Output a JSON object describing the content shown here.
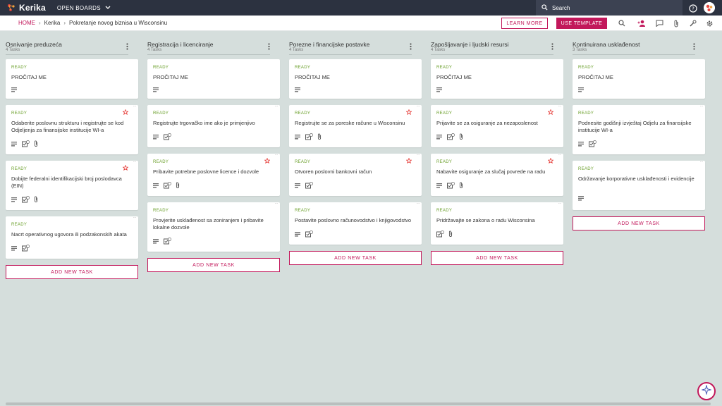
{
  "app": {
    "logo_text": "Kerika",
    "open_boards": "OPEN BOARDS"
  },
  "search": {
    "label": "Search"
  },
  "breadcrumb": {
    "home": "HOME",
    "org": "Kerika",
    "board": "Pokretanje novog biznisa u Wisconsinu"
  },
  "actions": {
    "learn_more": "LEARN MORE",
    "use_template": "USE TEMPLATE"
  },
  "colors": {
    "accent": "#c2185b",
    "ready": "#6a9f2a",
    "topbar": "#2c3240",
    "background": "#d5dedc"
  },
  "add_task_label": "ADD NEW TASK",
  "columns": [
    {
      "title": "Osnivanje preduzeća",
      "count": "4 Tasks",
      "cards": [
        {
          "status": "READY",
          "title": "PROČITAJ ME",
          "star": false,
          "icons": [
            "notes"
          ]
        },
        {
          "status": "READY",
          "title": "Odaberite poslovnu strukturu i registrujte se kod Odjeljenja za finansijske institucije WI-a",
          "star": true,
          "icons": [
            "notes",
            "checklist",
            "attachment"
          ]
        },
        {
          "status": "READY",
          "title": "Dobijte federalni identifikacijski broj poslodavca (EIN)",
          "star": true,
          "icons": [
            "notes",
            "checklist",
            "attachment"
          ]
        },
        {
          "status": "READY",
          "title": "Nacrt operativnog ugovora ili podzakonskih akata",
          "star": false,
          "icons": [
            "notes",
            "checklist"
          ]
        }
      ]
    },
    {
      "title": "Registracija i licenciranje",
      "count": "4 Tasks",
      "cards": [
        {
          "status": "READY",
          "title": "PROČITAJ ME",
          "star": false,
          "icons": [
            "notes"
          ]
        },
        {
          "status": "READY",
          "title": "Registrujte trgovačko ime ako je primjenjivo",
          "star": false,
          "icons": [
            "notes",
            "checklist"
          ]
        },
        {
          "status": "READY",
          "title": "Pribavite potrebne poslovne licence i dozvole",
          "star": true,
          "icons": [
            "notes",
            "checklist",
            "attachment"
          ]
        },
        {
          "status": "READY",
          "title": "Provjerite usklađenost sa zoniranjem i pribavite lokalne dozvole",
          "star": false,
          "icons": [
            "notes",
            "checklist"
          ]
        }
      ]
    },
    {
      "title": "Porezne i financijske postavke",
      "count": "4 Tasks",
      "cards": [
        {
          "status": "READY",
          "title": "PROČITAJ ME",
          "star": false,
          "icons": [
            "notes"
          ]
        },
        {
          "status": "READY",
          "title": "Registrujte se za poreske račune u Wisconsinu",
          "star": true,
          "icons": [
            "notes",
            "checklist",
            "attachment"
          ]
        },
        {
          "status": "READY",
          "title": "Otvoren poslovni bankovni račun",
          "star": true,
          "icons": [
            "notes",
            "checklist"
          ]
        },
        {
          "status": "READY",
          "title": "Postavite poslovno računovodstvo i knjigovodstvo",
          "star": false,
          "icons": [
            "notes",
            "checklist"
          ]
        }
      ]
    },
    {
      "title": "Zapošljavanje i ljudski resursi",
      "count": "4 Tasks",
      "cards": [
        {
          "status": "READY",
          "title": "PROČITAJ ME",
          "star": false,
          "icons": [
            "notes"
          ]
        },
        {
          "status": "READY",
          "title": "Prijavite se za osiguranje za nezaposlenost",
          "star": true,
          "icons": [
            "notes",
            "checklist",
            "attachment"
          ]
        },
        {
          "status": "READY",
          "title": "Nabavite osiguranje za slučaj povrede na radu",
          "star": true,
          "icons": [
            "notes",
            "checklist",
            "attachment"
          ]
        },
        {
          "status": "READY",
          "title": "Pridržavajte se zakona o radu Wisconsina",
          "star": false,
          "icons": [
            "checklist",
            "attachment"
          ]
        }
      ]
    },
    {
      "title": "Kontinuirana usklađenost",
      "count": "3 Tasks",
      "cards": [
        {
          "status": "READY",
          "title": "PROČITAJ ME",
          "star": false,
          "icons": [
            "notes"
          ]
        },
        {
          "status": "READY",
          "title": "Podnesite godišnji izvještaj Odjelu za finansijske institucije WI-a",
          "star": false,
          "icons": [
            "notes",
            "checklist"
          ]
        },
        {
          "status": "READY",
          "title": "Održavanje korporativne usklađenosti i evidencije",
          "star": false,
          "icons": [
            "notes"
          ]
        }
      ]
    }
  ]
}
